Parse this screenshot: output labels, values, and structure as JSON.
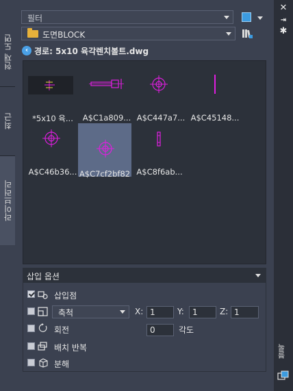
{
  "side_tabs": [
    "현재 도면",
    "최근",
    "라이브러리"
  ],
  "right_side_label": "블록",
  "filter": {
    "placeholder": "필터"
  },
  "folder_combo": {
    "value": "도면BLOCK"
  },
  "path": {
    "text": "경로: 5x10 육각렌치볼트.dwg"
  },
  "blocks": [
    {
      "label": "*5x10 육..."
    },
    {
      "label": "A$C1a809..."
    },
    {
      "label": "A$C447a7..."
    },
    {
      "label": "A$C45148..."
    },
    {
      "label": "A$C46b36..."
    },
    {
      "label": "A$C7cf2bf82"
    },
    {
      "label": "A$C8f6ab..."
    }
  ],
  "options": {
    "title": "삽입 옵션",
    "insertion_point": "삽입점",
    "scale_combo": "축척",
    "x_label": "X:",
    "y_label": "Y:",
    "z_label": "Z:",
    "x_value": "1",
    "y_value": "1",
    "z_value": "1",
    "rotation": "회전",
    "angle_value": "0",
    "angle_label": "각도",
    "repeat": "배치 반복",
    "explode": "분해"
  },
  "colors": {
    "magenta": "#e01ee0",
    "selected": "#5d6b88",
    "panel": "#3b4150"
  }
}
